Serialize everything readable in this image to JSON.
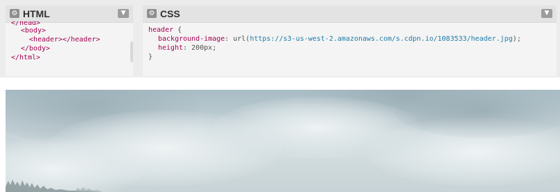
{
  "html_panel": {
    "title": "HTML",
    "gear_icon": "gear-icon",
    "collapse_icon": "chevron-down-icon",
    "code_lines": [
      "</head>",
      "<body>",
      "  <header></header>",
      "</body>",
      "</html>"
    ]
  },
  "css_panel": {
    "title": "CSS",
    "gear_icon": "gear-icon",
    "collapse_icon": "chevron-down-icon",
    "selector": "header",
    "open_brace": " {",
    "decl1_prop": "background-image",
    "decl1_colon": ": url(",
    "decl1_url": "https://s3-us-west-2.amazonaws.com/s.cdpn.io/1083533/header.jpg",
    "decl1_end": ");",
    "decl2_prop": "height",
    "decl2_value": ": 200px;",
    "close_brace": "}"
  },
  "result": {
    "image_subject": "cloudy sky with misty treeline"
  },
  "colors": {
    "tag_color": "#a50050",
    "url_color": "#1c7aa6",
    "pane_bg": "#f4f4f4",
    "header_bg": "#e3e3e3"
  }
}
